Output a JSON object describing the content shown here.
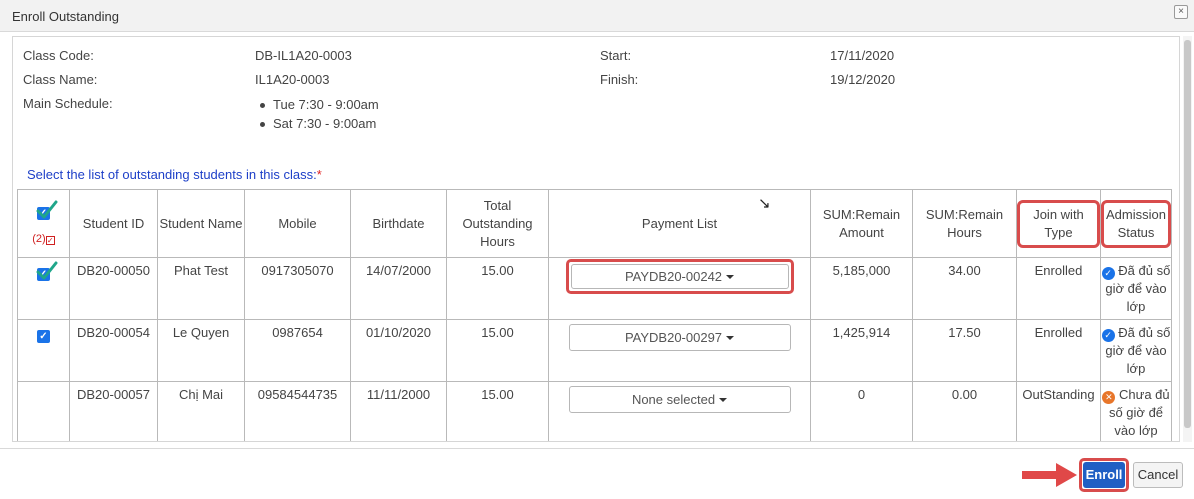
{
  "dialog": {
    "title": "Enroll Outstanding",
    "close_glyph": "×"
  },
  "class_info": {
    "code_label": "Class Code:",
    "code_value": "DB-IL1A20-0003",
    "name_label": "Class Name:",
    "name_value": "IL1A20-0003",
    "schedule_label": "Main Schedule:",
    "schedule_items": [
      "Tue 7:30 - 9:00am",
      "Sat 7:30 - 9:00am"
    ],
    "start_label": "Start:",
    "start_value": "17/11/2020",
    "finish_label": "Finish:",
    "finish_value": "19/12/2020"
  },
  "select_prompt": {
    "text": "Select the list of outstanding students in this class:",
    "required_mark": "*"
  },
  "table": {
    "selected_count": "(2)",
    "headers": {
      "student_id": "Student ID",
      "student_name": "Student Name",
      "mobile": "Mobile",
      "birthdate": "Birthdate",
      "total_hours": "Total Outstanding Hours",
      "payment_list": "Payment List",
      "remain_amount": "SUM:Remain Amount",
      "remain_hours": "SUM:Remain Hours",
      "join_type": "Join with Type",
      "admission_status": "Admission Status"
    },
    "rows": [
      {
        "checked": true,
        "student_id": "DB20-00050",
        "student_name": "Phat Test",
        "mobile": "0917305070",
        "birthdate": "14/07/2000",
        "total_hours": "15.00",
        "payment": "PAYDB20-00242",
        "remain_amount": "5,185,000",
        "remain_hours": "34.00",
        "join_type": "Enrolled",
        "status": "Đã đủ số giờ để vào lớp",
        "status_ok": true
      },
      {
        "checked": true,
        "student_id": "DB20-00054",
        "student_name": "Le Quyen",
        "mobile": "0987654",
        "birthdate": "01/10/2020",
        "total_hours": "15.00",
        "payment": "PAYDB20-00297",
        "remain_amount": "1,425,914",
        "remain_hours": "17.50",
        "join_type": "Enrolled",
        "status": "Đã đủ số giờ để vào lớp",
        "status_ok": true
      },
      {
        "checked": false,
        "student_id": "DB20-00057",
        "student_name": "Chị Mai",
        "mobile": "09584544735",
        "birthdate": "11/11/2000",
        "total_hours": "15.00",
        "payment": "None selected",
        "remain_amount": "0",
        "remain_hours": "0.00",
        "join_type": "OutStanding",
        "status": "Chưa đủ số giờ để vào lớp",
        "status_ok": false
      }
    ]
  },
  "footer": {
    "enroll_label": "Enroll",
    "cancel_label": "Cancel"
  },
  "icons": {
    "checkbox_checked": "checkbox-checked-icon",
    "status_ok": "check-circle-icon",
    "status_no": "x-circle-icon",
    "dropdown": "caret-down-icon"
  },
  "colors": {
    "primary": "#1f5fc4",
    "highlight": "#d84c4c",
    "enrolled": "#3d8b3d",
    "outstanding": "#f0a050",
    "tick": "#1fa68a"
  }
}
